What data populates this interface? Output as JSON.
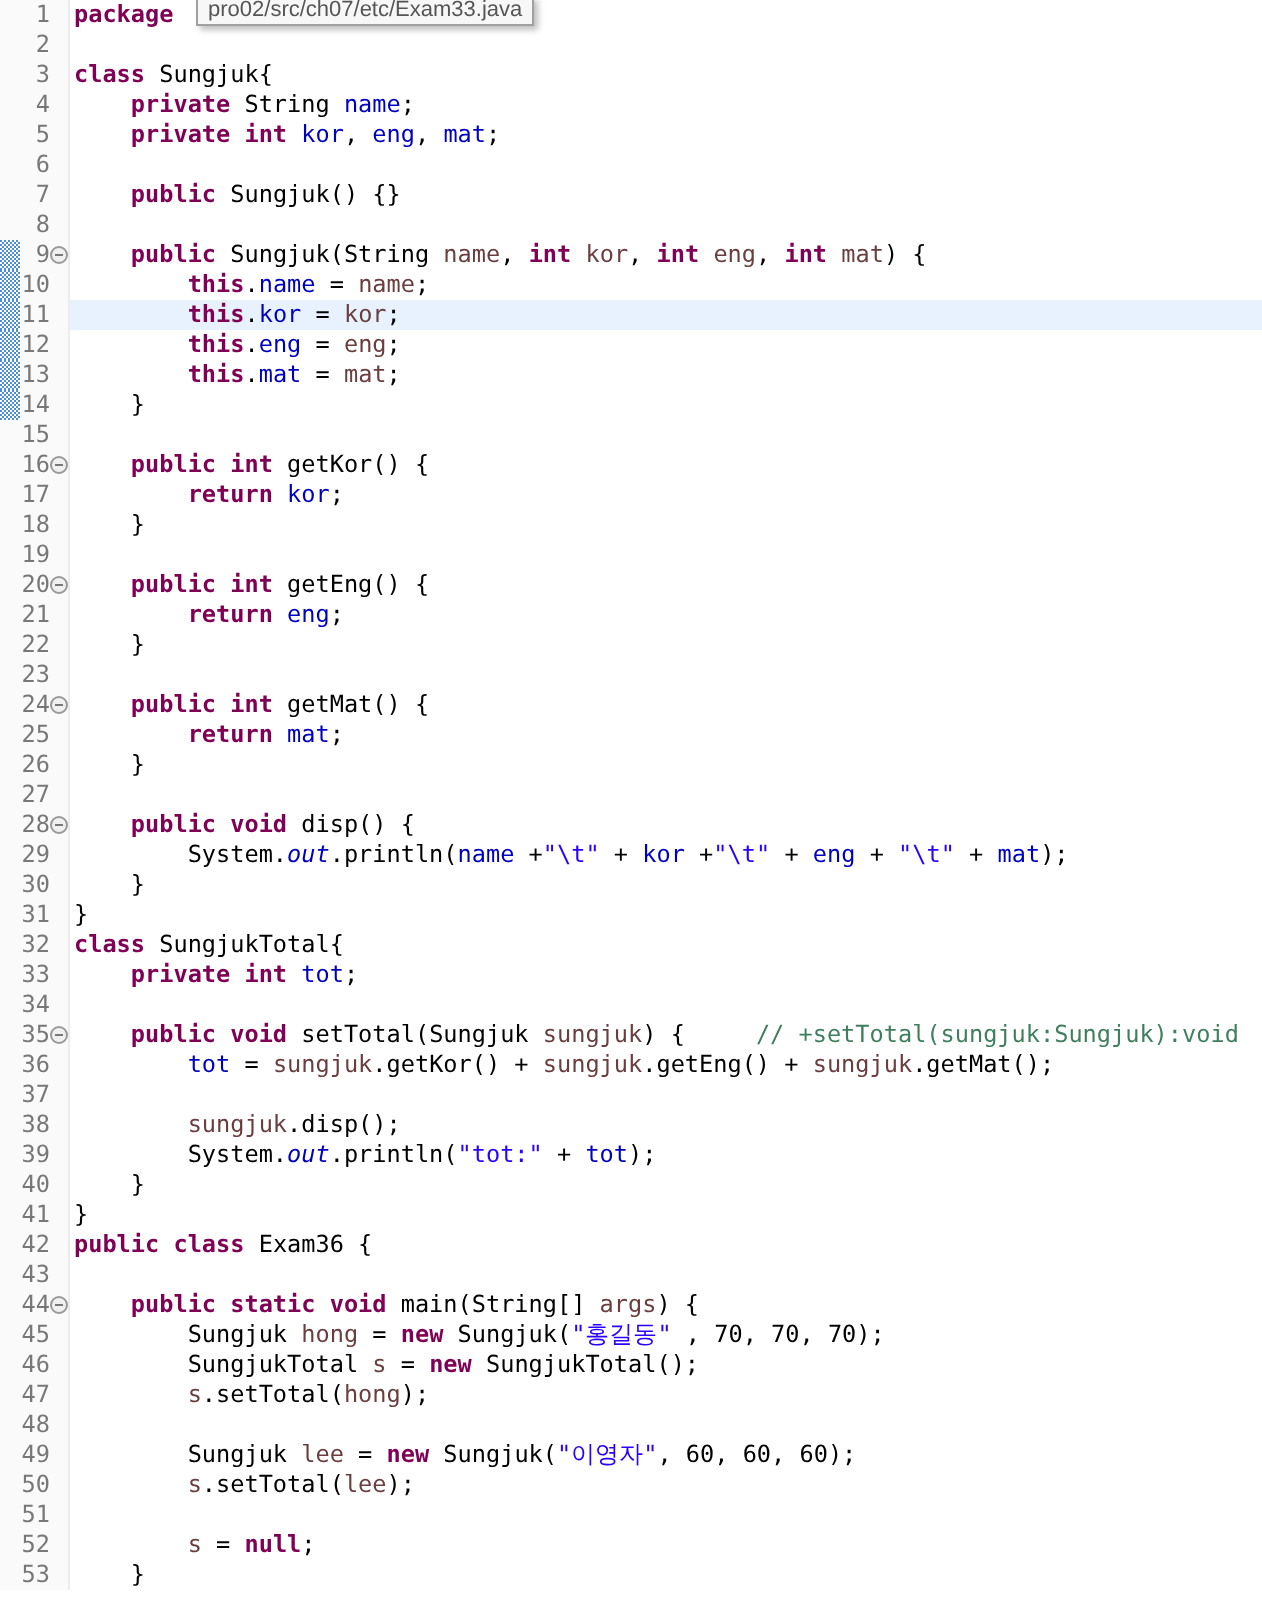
{
  "tooltip": {
    "text": "pro02/src/ch07/etc/Exam33.java"
  },
  "lines": [
    {
      "number": "1",
      "fold": false,
      "current": false,
      "changed": false,
      "tokens": [
        {
          "kind": "keyword",
          "text": "package"
        }
      ]
    },
    {
      "number": "2",
      "fold": false,
      "current": false,
      "changed": false
    },
    {
      "number": "3",
      "fold": false,
      "current": false,
      "changed": false,
      "tokens": [
        {
          "kind": "keyword",
          "text": "class"
        },
        {
          "kind": "plain",
          "text": " Sungjuk{"
        }
      ]
    },
    {
      "number": "4",
      "fold": false,
      "current": false,
      "changed": false,
      "tokens": [
        {
          "kind": "keyword",
          "text": "    private"
        },
        {
          "kind": "plain",
          "text": " String "
        },
        {
          "kind": "field",
          "text": "name"
        },
        {
          "kind": "plain",
          "text": ";"
        }
      ]
    },
    {
      "number": "5",
      "fold": false,
      "current": false,
      "changed": false,
      "tokens": [
        {
          "kind": "keyword",
          "text": "    private int "
        },
        {
          "kind": "field",
          "text": "kor"
        },
        {
          "kind": "plain",
          "text": ", "
        },
        {
          "kind": "field",
          "text": "eng"
        },
        {
          "kind": "plain",
          "text": ", "
        },
        {
          "kind": "field",
          "text": "mat"
        },
        {
          "kind": "plain",
          "text": ";"
        }
      ]
    },
    {
      "number": "6",
      "fold": false,
      "current": false,
      "changed": false
    },
    {
      "number": "7",
      "fold": false,
      "current": false,
      "changed": false,
      "tokens": [
        {
          "kind": "keyword",
          "text": "    public"
        },
        {
          "kind": "plain",
          "text": " Sungjuk() {}"
        }
      ]
    },
    {
      "number": "8",
      "fold": false,
      "current": false,
      "changed": false
    },
    {
      "number": "9",
      "fold": true,
      "current": false,
      "changed": true,
      "tokens": [
        {
          "kind": "keyword",
          "text": "    public"
        },
        {
          "kind": "plain",
          "text": " Sungjuk(String "
        },
        {
          "kind": "local",
          "text": "name"
        },
        {
          "kind": "plain",
          "text": ", "
        },
        {
          "kind": "keyword",
          "text": "int "
        },
        {
          "kind": "local",
          "text": "kor"
        },
        {
          "kind": "plain",
          "text": ", "
        },
        {
          "kind": "keyword",
          "text": "int "
        },
        {
          "kind": "local",
          "text": "eng"
        },
        {
          "kind": "plain",
          "text": ", "
        },
        {
          "kind": "keyword",
          "text": "int "
        },
        {
          "kind": "local",
          "text": "mat"
        },
        {
          "kind": "plain",
          "text": ") {"
        }
      ]
    },
    {
      "number": "10",
      "fold": false,
      "current": false,
      "changed": true,
      "tokens": [
        {
          "kind": "keyword",
          "text": "        this"
        },
        {
          "kind": "plain",
          "text": "."
        },
        {
          "kind": "field",
          "text": "name"
        },
        {
          "kind": "plain",
          "text": " = "
        },
        {
          "kind": "local",
          "text": "name"
        },
        {
          "kind": "plain",
          "text": ";"
        }
      ]
    },
    {
      "number": "11",
      "fold": false,
      "current": true,
      "changed": true,
      "tokens": [
        {
          "kind": "keyword",
          "text": "        this"
        },
        {
          "kind": "plain",
          "text": "."
        },
        {
          "kind": "field",
          "text": "kor"
        },
        {
          "kind": "plain",
          "text": " = "
        },
        {
          "kind": "local",
          "text": "kor"
        },
        {
          "kind": "plain",
          "text": ";"
        }
      ]
    },
    {
      "number": "12",
      "fold": false,
      "current": false,
      "changed": true,
      "tokens": [
        {
          "kind": "keyword",
          "text": "        this"
        },
        {
          "kind": "plain",
          "text": "."
        },
        {
          "kind": "field",
          "text": "eng"
        },
        {
          "kind": "plain",
          "text": " = "
        },
        {
          "kind": "local",
          "text": "eng"
        },
        {
          "kind": "plain",
          "text": ";"
        }
      ]
    },
    {
      "number": "13",
      "fold": false,
      "current": false,
      "changed": true,
      "tokens": [
        {
          "kind": "keyword",
          "text": "        this"
        },
        {
          "kind": "plain",
          "text": "."
        },
        {
          "kind": "field",
          "text": "mat"
        },
        {
          "kind": "plain",
          "text": " = "
        },
        {
          "kind": "local",
          "text": "mat"
        },
        {
          "kind": "plain",
          "text": ";"
        }
      ]
    },
    {
      "number": "14",
      "fold": false,
      "current": false,
      "changed": true,
      "tokens": [
        {
          "kind": "plain",
          "text": "    }"
        }
      ]
    },
    {
      "number": "15",
      "fold": false,
      "current": false,
      "changed": false
    },
    {
      "number": "16",
      "fold": true,
      "current": false,
      "changed": false,
      "tokens": [
        {
          "kind": "keyword",
          "text": "    public int"
        },
        {
          "kind": "plain",
          "text": " getKor() {"
        }
      ]
    },
    {
      "number": "17",
      "fold": false,
      "current": false,
      "changed": false,
      "tokens": [
        {
          "kind": "keyword",
          "text": "        return "
        },
        {
          "kind": "field",
          "text": "kor"
        },
        {
          "kind": "plain",
          "text": ";"
        }
      ]
    },
    {
      "number": "18",
      "fold": false,
      "current": false,
      "changed": false,
      "tokens": [
        {
          "kind": "plain",
          "text": "    }"
        }
      ]
    },
    {
      "number": "19",
      "fold": false,
      "current": false,
      "changed": false
    },
    {
      "number": "20",
      "fold": true,
      "current": false,
      "changed": false,
      "tokens": [
        {
          "kind": "keyword",
          "text": "    public int"
        },
        {
          "kind": "plain",
          "text": " getEng() {"
        }
      ]
    },
    {
      "number": "21",
      "fold": false,
      "current": false,
      "changed": false,
      "tokens": [
        {
          "kind": "keyword",
          "text": "        return "
        },
        {
          "kind": "field",
          "text": "eng"
        },
        {
          "kind": "plain",
          "text": ";"
        }
      ]
    },
    {
      "number": "22",
      "fold": false,
      "current": false,
      "changed": false,
      "tokens": [
        {
          "kind": "plain",
          "text": "    }"
        }
      ]
    },
    {
      "number": "23",
      "fold": false,
      "current": false,
      "changed": false
    },
    {
      "number": "24",
      "fold": true,
      "current": false,
      "changed": false,
      "tokens": [
        {
          "kind": "keyword",
          "text": "    public int"
        },
        {
          "kind": "plain",
          "text": " getMat() {"
        }
      ]
    },
    {
      "number": "25",
      "fold": false,
      "current": false,
      "changed": false,
      "tokens": [
        {
          "kind": "keyword",
          "text": "        return "
        },
        {
          "kind": "field",
          "text": "mat"
        },
        {
          "kind": "plain",
          "text": ";"
        }
      ]
    },
    {
      "number": "26",
      "fold": false,
      "current": false,
      "changed": false,
      "tokens": [
        {
          "kind": "plain",
          "text": "    }"
        }
      ]
    },
    {
      "number": "27",
      "fold": false,
      "current": false,
      "changed": false
    },
    {
      "number": "28",
      "fold": true,
      "current": false,
      "changed": false,
      "tokens": [
        {
          "kind": "keyword",
          "text": "    public void"
        },
        {
          "kind": "plain",
          "text": " disp() {"
        }
      ]
    },
    {
      "number": "29",
      "fold": false,
      "current": false,
      "changed": false,
      "tokens": [
        {
          "kind": "plain",
          "text": "        System."
        },
        {
          "kind": "static",
          "text": "out"
        },
        {
          "kind": "plain",
          "text": ".println("
        },
        {
          "kind": "field",
          "text": "name"
        },
        {
          "kind": "plain",
          "text": " +"
        },
        {
          "kind": "string",
          "text": "\"\\t\""
        },
        {
          "kind": "plain",
          "text": " + "
        },
        {
          "kind": "field",
          "text": "kor"
        },
        {
          "kind": "plain",
          "text": " +"
        },
        {
          "kind": "string",
          "text": "\"\\t\""
        },
        {
          "kind": "plain",
          "text": " + "
        },
        {
          "kind": "field",
          "text": "eng"
        },
        {
          "kind": "plain",
          "text": " + "
        },
        {
          "kind": "string",
          "text": "\"\\t\""
        },
        {
          "kind": "plain",
          "text": " + "
        },
        {
          "kind": "field",
          "text": "mat"
        },
        {
          "kind": "plain",
          "text": ");"
        }
      ]
    },
    {
      "number": "30",
      "fold": false,
      "current": false,
      "changed": false,
      "tokens": [
        {
          "kind": "plain",
          "text": "    }"
        }
      ]
    },
    {
      "number": "31",
      "fold": false,
      "current": false,
      "changed": false,
      "tokens": [
        {
          "kind": "plain",
          "text": "}"
        }
      ]
    },
    {
      "number": "32",
      "fold": false,
      "current": false,
      "changed": false,
      "tokens": [
        {
          "kind": "keyword",
          "text": "class"
        },
        {
          "kind": "plain",
          "text": " SungjukTotal{"
        }
      ]
    },
    {
      "number": "33",
      "fold": false,
      "current": false,
      "changed": false,
      "tokens": [
        {
          "kind": "keyword",
          "text": "    private int "
        },
        {
          "kind": "field",
          "text": "tot"
        },
        {
          "kind": "plain",
          "text": ";"
        }
      ]
    },
    {
      "number": "34",
      "fold": false,
      "current": false,
      "changed": false
    },
    {
      "number": "35",
      "fold": true,
      "current": false,
      "changed": false,
      "tokens": [
        {
          "kind": "keyword",
          "text": "    public void"
        },
        {
          "kind": "plain",
          "text": " setTotal(Sungjuk "
        },
        {
          "kind": "local",
          "text": "sungjuk"
        },
        {
          "kind": "plain",
          "text": ") {     "
        },
        {
          "kind": "comment",
          "text": "// +setTotal(sungjuk:Sungjuk):void"
        }
      ]
    },
    {
      "number": "36",
      "fold": false,
      "current": false,
      "changed": false,
      "tokens": [
        {
          "kind": "field",
          "text": "        tot"
        },
        {
          "kind": "plain",
          "text": " = "
        },
        {
          "kind": "local",
          "text": "sungjuk"
        },
        {
          "kind": "plain",
          "text": ".getKor() + "
        },
        {
          "kind": "local",
          "text": "sungjuk"
        },
        {
          "kind": "plain",
          "text": ".getEng() + "
        },
        {
          "kind": "local",
          "text": "sungjuk"
        },
        {
          "kind": "plain",
          "text": ".getMat();"
        }
      ]
    },
    {
      "number": "37",
      "fold": false,
      "current": false,
      "changed": false
    },
    {
      "number": "38",
      "fold": false,
      "current": false,
      "changed": false,
      "tokens": [
        {
          "kind": "local",
          "text": "        sungjuk"
        },
        {
          "kind": "plain",
          "text": ".disp();"
        }
      ]
    },
    {
      "number": "39",
      "fold": false,
      "current": false,
      "changed": false,
      "tokens": [
        {
          "kind": "plain",
          "text": "        System."
        },
        {
          "kind": "static",
          "text": "out"
        },
        {
          "kind": "plain",
          "text": ".println("
        },
        {
          "kind": "string",
          "text": "\"tot:\""
        },
        {
          "kind": "plain",
          "text": " + "
        },
        {
          "kind": "field",
          "text": "tot"
        },
        {
          "kind": "plain",
          "text": ");"
        }
      ]
    },
    {
      "number": "40",
      "fold": false,
      "current": false,
      "changed": false,
      "tokens": [
        {
          "kind": "plain",
          "text": "    }"
        }
      ]
    },
    {
      "number": "41",
      "fold": false,
      "current": false,
      "changed": false,
      "tokens": [
        {
          "kind": "plain",
          "text": "}"
        }
      ]
    },
    {
      "number": "42",
      "fold": false,
      "current": false,
      "changed": false,
      "tokens": [
        {
          "kind": "keyword",
          "text": "public class"
        },
        {
          "kind": "plain",
          "text": " Exam36 {"
        }
      ]
    },
    {
      "number": "43",
      "fold": false,
      "current": false,
      "changed": false
    },
    {
      "number": "44",
      "fold": true,
      "current": false,
      "changed": false,
      "tokens": [
        {
          "kind": "keyword",
          "text": "    public static void"
        },
        {
          "kind": "plain",
          "text": " main(String[] "
        },
        {
          "kind": "local",
          "text": "args"
        },
        {
          "kind": "plain",
          "text": ") {"
        }
      ]
    },
    {
      "number": "45",
      "fold": false,
      "current": false,
      "changed": false,
      "tokens": [
        {
          "kind": "plain",
          "text": "        Sungjuk "
        },
        {
          "kind": "local",
          "text": "hong"
        },
        {
          "kind": "plain",
          "text": " = "
        },
        {
          "kind": "keyword",
          "text": "new"
        },
        {
          "kind": "plain",
          "text": " Sungjuk("
        },
        {
          "kind": "string",
          "text": "\"홍길동\""
        },
        {
          "kind": "plain",
          "text": " , 70, 70, 70);"
        }
      ]
    },
    {
      "number": "46",
      "fold": false,
      "current": false,
      "changed": false,
      "tokens": [
        {
          "kind": "plain",
          "text": "        SungjukTotal "
        },
        {
          "kind": "local",
          "text": "s"
        },
        {
          "kind": "plain",
          "text": " = "
        },
        {
          "kind": "keyword",
          "text": "new"
        },
        {
          "kind": "plain",
          "text": " SungjukTotal();"
        }
      ]
    },
    {
      "number": "47",
      "fold": false,
      "current": false,
      "changed": false,
      "tokens": [
        {
          "kind": "local",
          "text": "        s"
        },
        {
          "kind": "plain",
          "text": ".setTotal("
        },
        {
          "kind": "local",
          "text": "hong"
        },
        {
          "kind": "plain",
          "text": ");"
        }
      ]
    },
    {
      "number": "48",
      "fold": false,
      "current": false,
      "changed": false
    },
    {
      "number": "49",
      "fold": false,
      "current": false,
      "changed": false,
      "tokens": [
        {
          "kind": "plain",
          "text": "        Sungjuk "
        },
        {
          "kind": "local",
          "text": "lee"
        },
        {
          "kind": "plain",
          "text": " = "
        },
        {
          "kind": "keyword",
          "text": "new"
        },
        {
          "kind": "plain",
          "text": " Sungjuk("
        },
        {
          "kind": "string",
          "text": "\"이영자\""
        },
        {
          "kind": "plain",
          "text": ", 60, 60, 60);"
        }
      ]
    },
    {
      "number": "50",
      "fold": false,
      "current": false,
      "changed": false,
      "tokens": [
        {
          "kind": "local",
          "text": "        s"
        },
        {
          "kind": "plain",
          "text": ".setTotal("
        },
        {
          "kind": "local",
          "text": "lee"
        },
        {
          "kind": "plain",
          "text": ");"
        }
      ]
    },
    {
      "number": "51",
      "fold": false,
      "current": false,
      "changed": false
    },
    {
      "number": "52",
      "fold": false,
      "current": false,
      "changed": false,
      "tokens": [
        {
          "kind": "local",
          "text": "        s"
        },
        {
          "kind": "plain",
          "text": " = "
        },
        {
          "kind": "keyword",
          "text": "null"
        },
        {
          "kind": "plain",
          "text": ";"
        }
      ]
    },
    {
      "number": "53",
      "fold": false,
      "current": false,
      "changed": false,
      "tokens": [
        {
          "kind": "plain",
          "text": "    }"
        }
      ]
    }
  ]
}
